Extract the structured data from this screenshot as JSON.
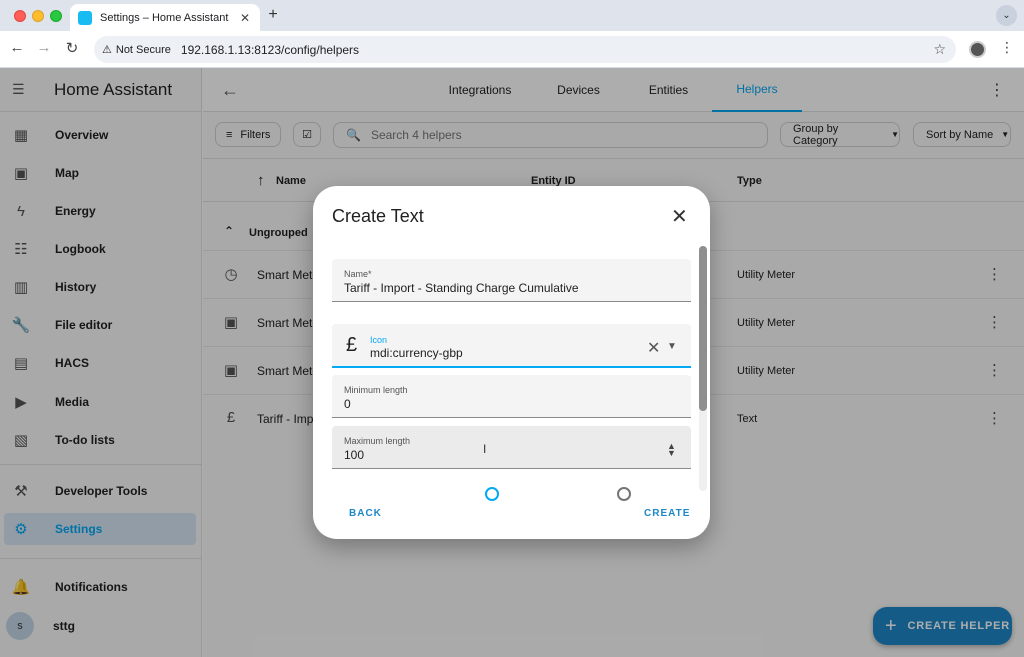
{
  "browser": {
    "tab_title": "Settings – Home Assistant",
    "tab_close": "✕",
    "new_tab": "+",
    "not_secure_label": "Not Secure",
    "url": "192.168.1.13:8123/config/helpers"
  },
  "sidebar": {
    "title": "Home Assistant",
    "items": [
      {
        "label": "Overview",
        "icon": "view-dashboard-icon"
      },
      {
        "label": "Map",
        "icon": "map-icon"
      },
      {
        "label": "Energy",
        "icon": "lightning-icon"
      },
      {
        "label": "Logbook",
        "icon": "list-icon"
      },
      {
        "label": "History",
        "icon": "chart-icon"
      },
      {
        "label": "File editor",
        "icon": "wrench-icon"
      },
      {
        "label": "HACS",
        "icon": "hacs-icon"
      },
      {
        "label": "Media",
        "icon": "media-icon"
      },
      {
        "label": "To-do lists",
        "icon": "clipboard-icon"
      },
      {
        "label": "Developer Tools",
        "icon": "hammer-icon"
      },
      {
        "label": "Settings",
        "icon": "gear-icon"
      },
      {
        "label": "Notifications",
        "icon": "bell-icon"
      },
      {
        "label": "sttg",
        "avatar": "s"
      }
    ]
  },
  "header": {
    "tabs": [
      "Integrations",
      "Devices",
      "Entities",
      "Helpers"
    ],
    "active_tab": "Helpers"
  },
  "toolbar": {
    "filters_label": "Filters",
    "search_placeholder": "Search 4 helpers",
    "group_by_label": "Group by Category",
    "sort_by_label": "Sort by Name"
  },
  "table": {
    "columns": {
      "name": "Name",
      "entity_id": "Entity ID",
      "type": "Type"
    },
    "group_label": "Ungrouped",
    "rows": [
      {
        "name": "Smart Mete",
        "type": "Utility Meter",
        "icon": "clock-icon"
      },
      {
        "name": "Smart Mete",
        "type": "Utility Meter",
        "icon": "meter-icon"
      },
      {
        "name": "Smart Mete",
        "type": "Utility Meter",
        "icon": "meter-icon"
      },
      {
        "name": "Tariff - Imp",
        "type": "Text",
        "icon": "currency-gbp-icon"
      }
    ]
  },
  "fab": {
    "label": "CREATE HELPER"
  },
  "dialog": {
    "title": "Create Text",
    "fields": {
      "name_label": "Name*",
      "name_value": "Tariff - Import - Standing Charge Cumulative",
      "icon_label": "Icon",
      "icon_value": "mdi:currency-gbp",
      "min_label": "Minimum length",
      "min_value": "0",
      "max_label": "Maximum length",
      "max_value": "100"
    },
    "back_label": "BACK",
    "create_label": "CREATE"
  },
  "colors": {
    "accent": "#03a9f4",
    "fab": "#1e88c7",
    "active_sidebar_bg": "#d6e6f5"
  }
}
